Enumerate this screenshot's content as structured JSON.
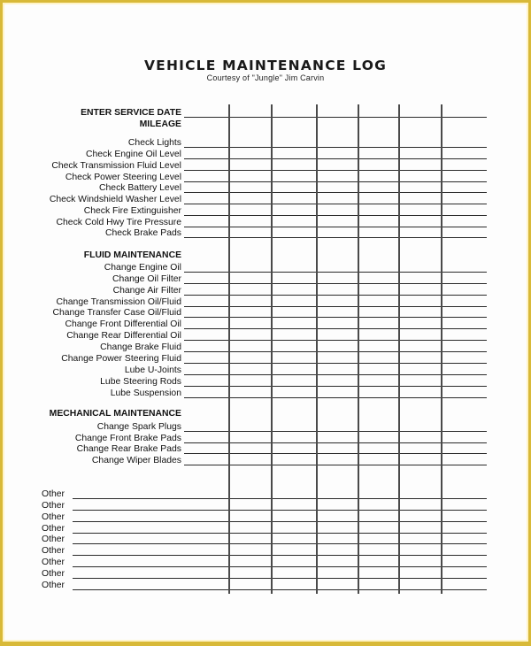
{
  "document": {
    "title": "VEHICLE MAINTENANCE LOG",
    "subtitle": "Courtesy of \"Jungle\" Jim Carvin"
  },
  "header_rows": [
    {
      "label": "ENTER SERVICE DATE"
    },
    {
      "label": "MILEAGE"
    }
  ],
  "sections": {
    "checks": {
      "title": "",
      "items": [
        "Check Lights",
        "Check Engine Oil Level",
        "Check Transmission Fluid Level",
        "Check Power Steering Level",
        "Check Battery Level",
        "Check Windshield Washer Level",
        "Check Fire Extinguisher",
        "Check Cold Hwy Tire Pressure",
        "Check Brake Pads"
      ]
    },
    "fluid": {
      "title": "FLUID MAINTENANCE",
      "items": [
        "Change Engine Oil",
        "Change Oil Filter",
        "Change Air Filter",
        "Change Transmission Oil/Fluid",
        "Change Transfer Case Oil/Fluid",
        "Change Front Differential Oil",
        "Change Rear Differential Oil",
        "Change Brake Fluid",
        "Change Power Steering Fluid",
        "Lube U-Joints",
        "Lube Steering Rods",
        "Lube Suspension"
      ]
    },
    "mechanical": {
      "title": "MECHANICAL MAINTENANCE",
      "items": [
        "Change Spark Plugs",
        "Change Front Brake Pads",
        "Change Rear Brake Pads",
        "Change Wiper Blades"
      ]
    },
    "other": {
      "items": [
        "Other",
        "Other",
        "Other",
        "Other",
        "Other",
        "Other",
        "Other",
        "Other",
        "Other"
      ]
    }
  },
  "service_columns": 6,
  "colors": {
    "frame": "#d8b938",
    "ink": "#111111"
  }
}
